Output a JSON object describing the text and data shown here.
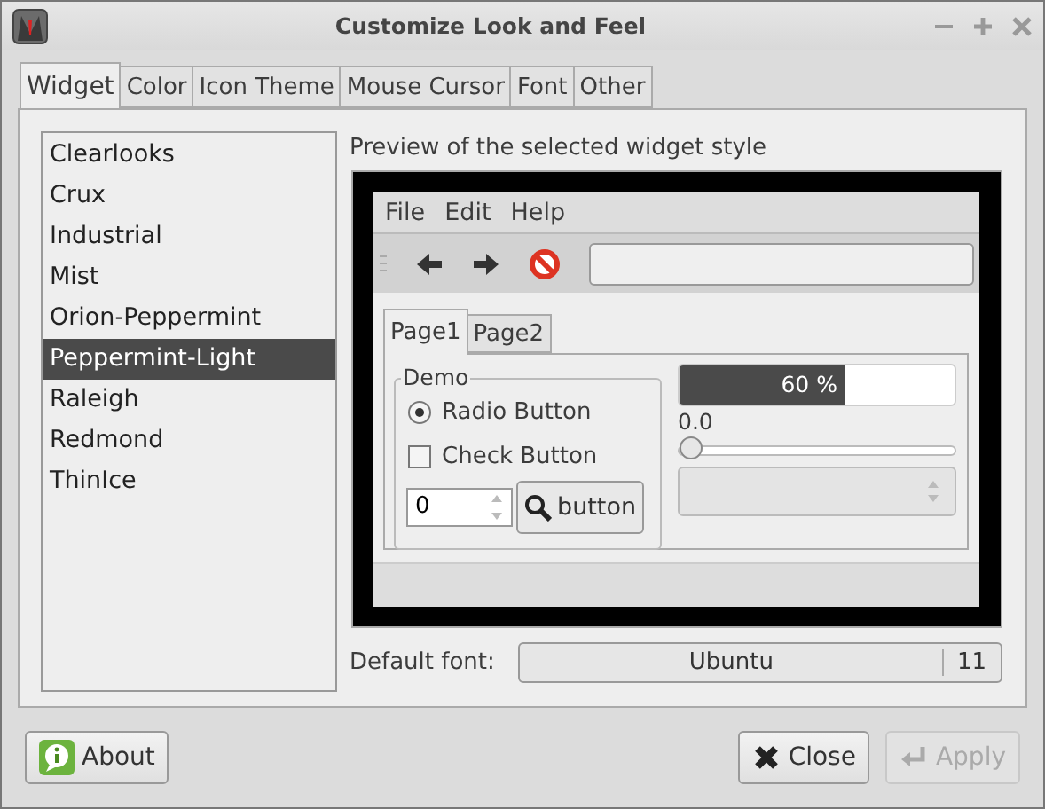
{
  "window": {
    "title": "Customize Look and Feel"
  },
  "tabs": [
    {
      "label": "Widget",
      "selected": true
    },
    {
      "label": "Color",
      "selected": false
    },
    {
      "label": "Icon Theme",
      "selected": false
    },
    {
      "label": "Mouse Cursor",
      "selected": false
    },
    {
      "label": "Font",
      "selected": false
    },
    {
      "label": "Other",
      "selected": false
    }
  ],
  "themes": [
    {
      "label": "Clearlooks",
      "selected": false
    },
    {
      "label": "Crux",
      "selected": false
    },
    {
      "label": "Industrial",
      "selected": false
    },
    {
      "label": "Mist",
      "selected": false
    },
    {
      "label": "Orion-Peppermint",
      "selected": false
    },
    {
      "label": "Peppermint-Light",
      "selected": true
    },
    {
      "label": "Raleigh",
      "selected": false
    },
    {
      "label": "Redmond",
      "selected": false
    },
    {
      "label": "ThinIce",
      "selected": false
    }
  ],
  "preview": {
    "heading": "Preview of the selected widget style",
    "menu": [
      "File",
      "Edit",
      "Help"
    ],
    "tabs": [
      {
        "label": "Page1",
        "selected": true
      },
      {
        "label": "Page2",
        "selected": false
      }
    ],
    "frame_label": "Demo",
    "radio": {
      "label": "Radio Button",
      "checked": true
    },
    "check": {
      "label": "Check Button",
      "checked": false
    },
    "spin_value": "0",
    "button": "button",
    "progress": {
      "level": 0.6,
      "text": "60 %"
    },
    "scale": {
      "reading": "0.0",
      "level": 0
    }
  },
  "font": {
    "label": "Default font:",
    "name": "Ubuntu",
    "size": "11"
  },
  "buttons": [
    {
      "kind": "about",
      "label": "About",
      "disabled": false
    },
    {
      "kind": "close",
      "label": "Close",
      "disabled": false
    },
    {
      "kind": "apply",
      "label": "Apply",
      "disabled": true
    }
  ]
}
